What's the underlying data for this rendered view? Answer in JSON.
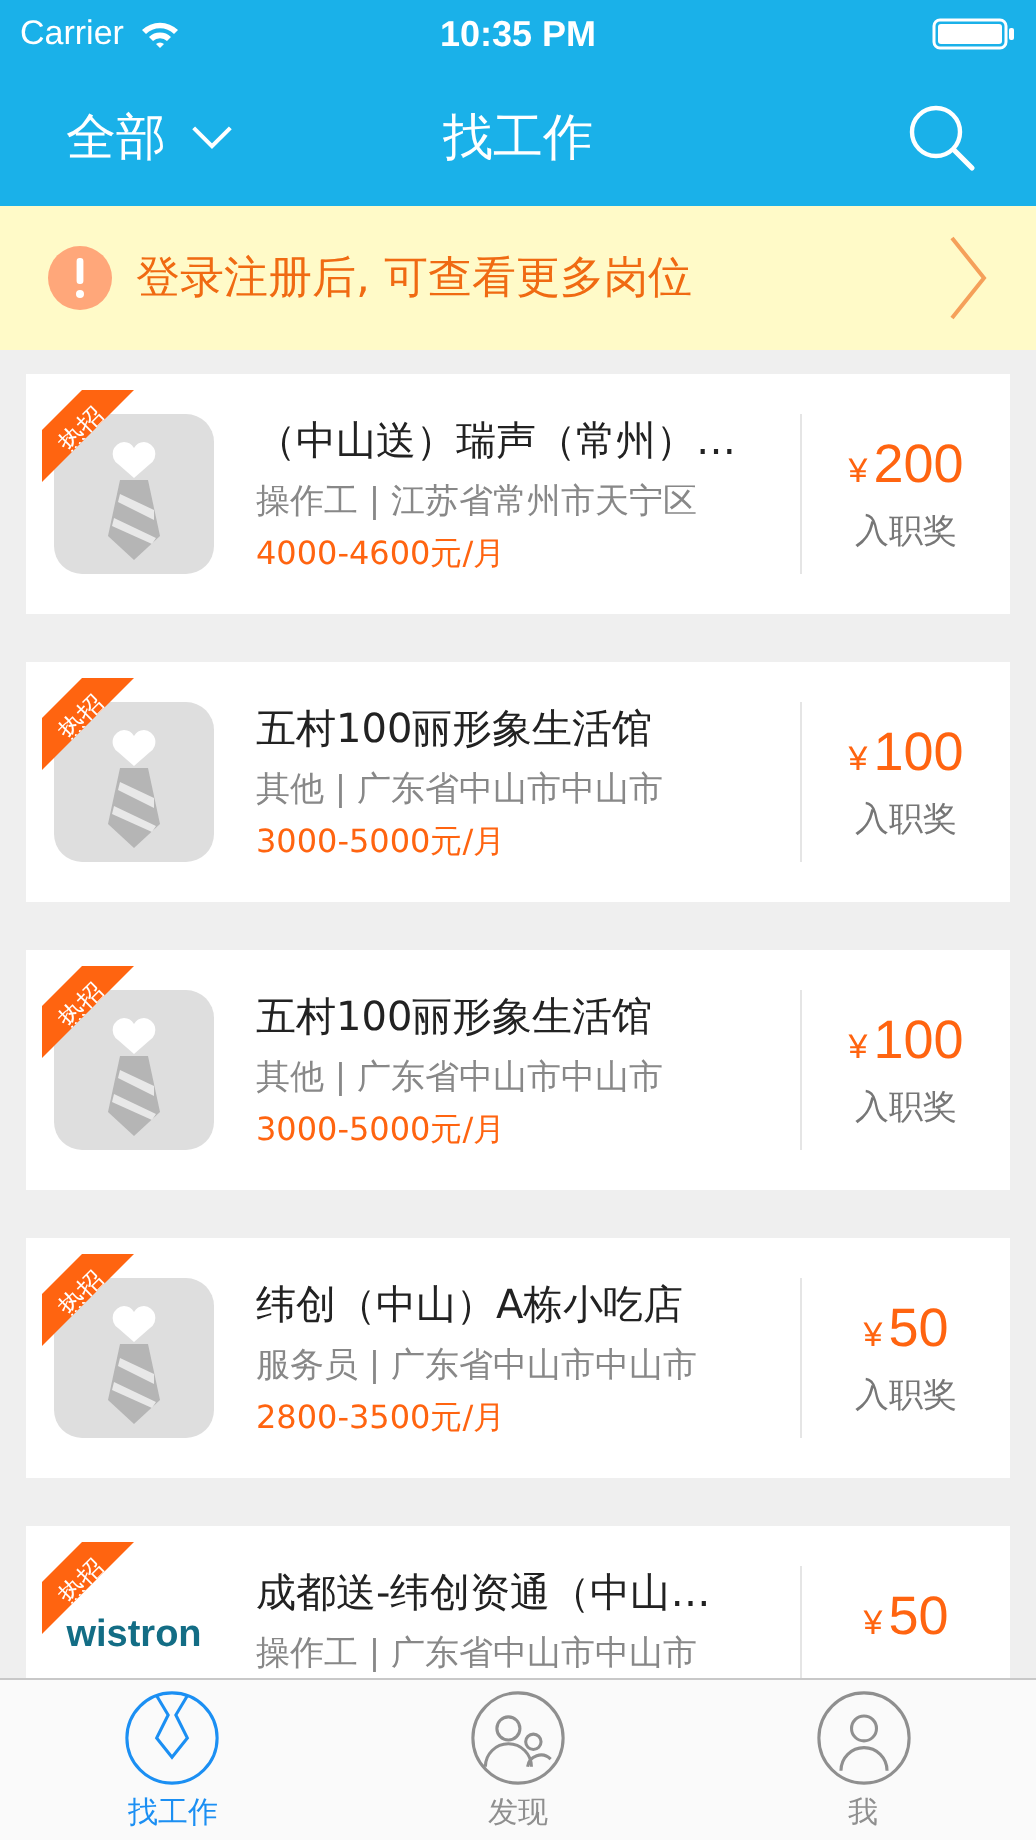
{
  "status_bar": {
    "carrier": "Carrier",
    "time": "10:35 PM"
  },
  "nav": {
    "filter": "全部",
    "title": "找工作"
  },
  "notice": {
    "text": "登录注册后, 可查看更多岗位"
  },
  "jobs": [
    {
      "kind": "tie",
      "hot": true,
      "badge": "热招",
      "title": "（中山送）瑞声（常州）…",
      "subtitle": "操作工 | 江苏省常州市天宁区",
      "salary": "4000-4600元/月",
      "currency": "¥",
      "amount": "200",
      "reward_label": "入职奖"
    },
    {
      "kind": "tie",
      "hot": true,
      "badge": "热招",
      "title": "五村100丽形象生活馆",
      "subtitle": "其他 | 广东省中山市中山市",
      "salary": "3000-5000元/月",
      "currency": "¥",
      "amount": "100",
      "reward_label": "入职奖"
    },
    {
      "kind": "tie",
      "hot": true,
      "badge": "热招",
      "title": "五村100丽形象生活馆",
      "subtitle": "其他 | 广东省中山市中山市",
      "salary": "3000-5000元/月",
      "currency": "¥",
      "amount": "100",
      "reward_label": "入职奖"
    },
    {
      "kind": "tie",
      "hot": true,
      "badge": "热招",
      "title": "纬创（中山）A栋小吃店",
      "subtitle": "服务员 | 广东省中山市中山市",
      "salary": "2800-3500元/月",
      "currency": "¥",
      "amount": "50",
      "reward_label": "入职奖"
    },
    {
      "kind": "logo",
      "logo_text": "wistron",
      "hot": true,
      "badge": "热招",
      "title": "成都送-纬创资通（中山…",
      "subtitle": "操作工 | 广东省中山市中山市",
      "currency": "¥",
      "amount": "50"
    }
  ],
  "tabs": [
    {
      "label": "找工作",
      "selected": true
    },
    {
      "label": "发现",
      "selected": false
    },
    {
      "label": "我",
      "selected": false
    }
  ]
}
